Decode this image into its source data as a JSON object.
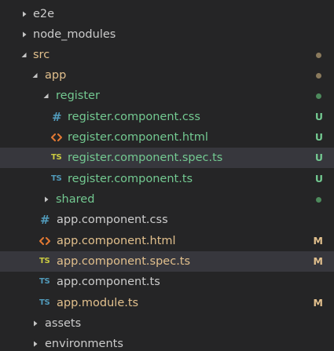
{
  "colors": {
    "background": "#252526",
    "selected_row": "#37373d",
    "default_text": "#cccccc",
    "untracked_text": "#73c991",
    "modified_text": "#e2c08d",
    "css_icon": "#519aba",
    "html_icon": "#e37933",
    "ts_icon": "#519aba",
    "spec_ts_icon": "#cbcb41",
    "modified_dot": "#8a7a5c",
    "untracked_dot": "#4d8a5c"
  },
  "explorer": {
    "rows": [
      {
        "label": "e2e",
        "type": "folder",
        "state": "collapsed",
        "icon": "chevron-right-icon"
      },
      {
        "label": "node_modules",
        "type": "folder",
        "state": "collapsed",
        "icon": "chevron-right-icon"
      },
      {
        "label": "src",
        "type": "folder",
        "state": "expanded",
        "icon": "chevron-down-icon",
        "decoration": "modified-dot"
      },
      {
        "label": "app",
        "type": "folder",
        "state": "expanded",
        "icon": "chevron-down-icon",
        "decoration": "modified-dot"
      },
      {
        "label": "register",
        "type": "folder",
        "state": "expanded",
        "icon": "chevron-down-icon",
        "decoration": "untracked-dot"
      },
      {
        "label": "register.component.css",
        "type": "file",
        "icon": "css-hash-icon",
        "icon_glyph": "#",
        "badge": "U"
      },
      {
        "label": "register.component.html",
        "type": "file",
        "icon": "html-angle-brackets-icon",
        "icon_glyph": "<>",
        "badge": "U"
      },
      {
        "label": "register.component.spec.ts",
        "type": "file",
        "icon": "typescript-spec-icon",
        "icon_glyph": "TS",
        "badge": "U",
        "selected": true
      },
      {
        "label": "register.component.ts",
        "type": "file",
        "icon": "typescript-icon",
        "icon_glyph": "TS",
        "badge": "U"
      },
      {
        "label": "shared",
        "type": "folder",
        "state": "collapsed",
        "icon": "chevron-right-icon",
        "decoration": "untracked-dot"
      },
      {
        "label": "app.component.css",
        "type": "file",
        "icon": "css-hash-icon",
        "icon_glyph": "#"
      },
      {
        "label": "app.component.html",
        "type": "file",
        "icon": "html-angle-brackets-icon",
        "icon_glyph": "<>",
        "badge": "M"
      },
      {
        "label": "app.component.spec.ts",
        "type": "file",
        "icon": "typescript-spec-icon",
        "icon_glyph": "TS",
        "badge": "M",
        "selected": true
      },
      {
        "label": "app.component.ts",
        "type": "file",
        "icon": "typescript-icon",
        "icon_glyph": "TS"
      },
      {
        "label": "app.module.ts",
        "type": "file",
        "icon": "typescript-icon",
        "icon_glyph": "TS",
        "badge": "M"
      },
      {
        "label": "assets",
        "type": "folder",
        "state": "collapsed",
        "icon": "chevron-right-icon"
      },
      {
        "label": "environments",
        "type": "folder",
        "state": "collapsed",
        "icon": "chevron-right-icon"
      }
    ]
  }
}
